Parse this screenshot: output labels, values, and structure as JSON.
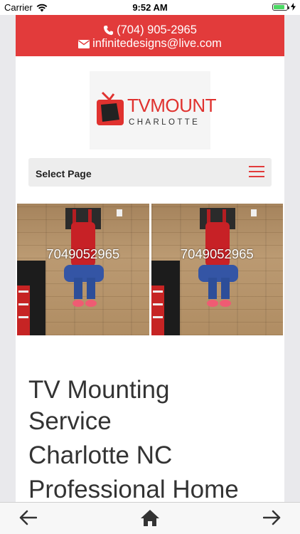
{
  "status_bar": {
    "carrier": "Carrier",
    "time": "9:52 AM"
  },
  "header": {
    "phone": "(704) 905-2965",
    "email": "infinitedesigns@live.com",
    "accent_color": "#e23b3b"
  },
  "logo": {
    "word": "TVMOUNT",
    "sub": "CHARLOTTE"
  },
  "nav": {
    "label": "Select Page"
  },
  "gallery": [
    {
      "overlay_text": "7049052965"
    },
    {
      "overlay_text": "7049052965"
    }
  ],
  "main": {
    "heading_line1": "TV Mounting",
    "heading_line2": "Service",
    "heading_line3": "Charlotte NC",
    "heading_line4": "Professional Home"
  },
  "icons": {
    "back": "arrow-left-icon",
    "home": "home-icon",
    "forward": "arrow-right-icon"
  }
}
